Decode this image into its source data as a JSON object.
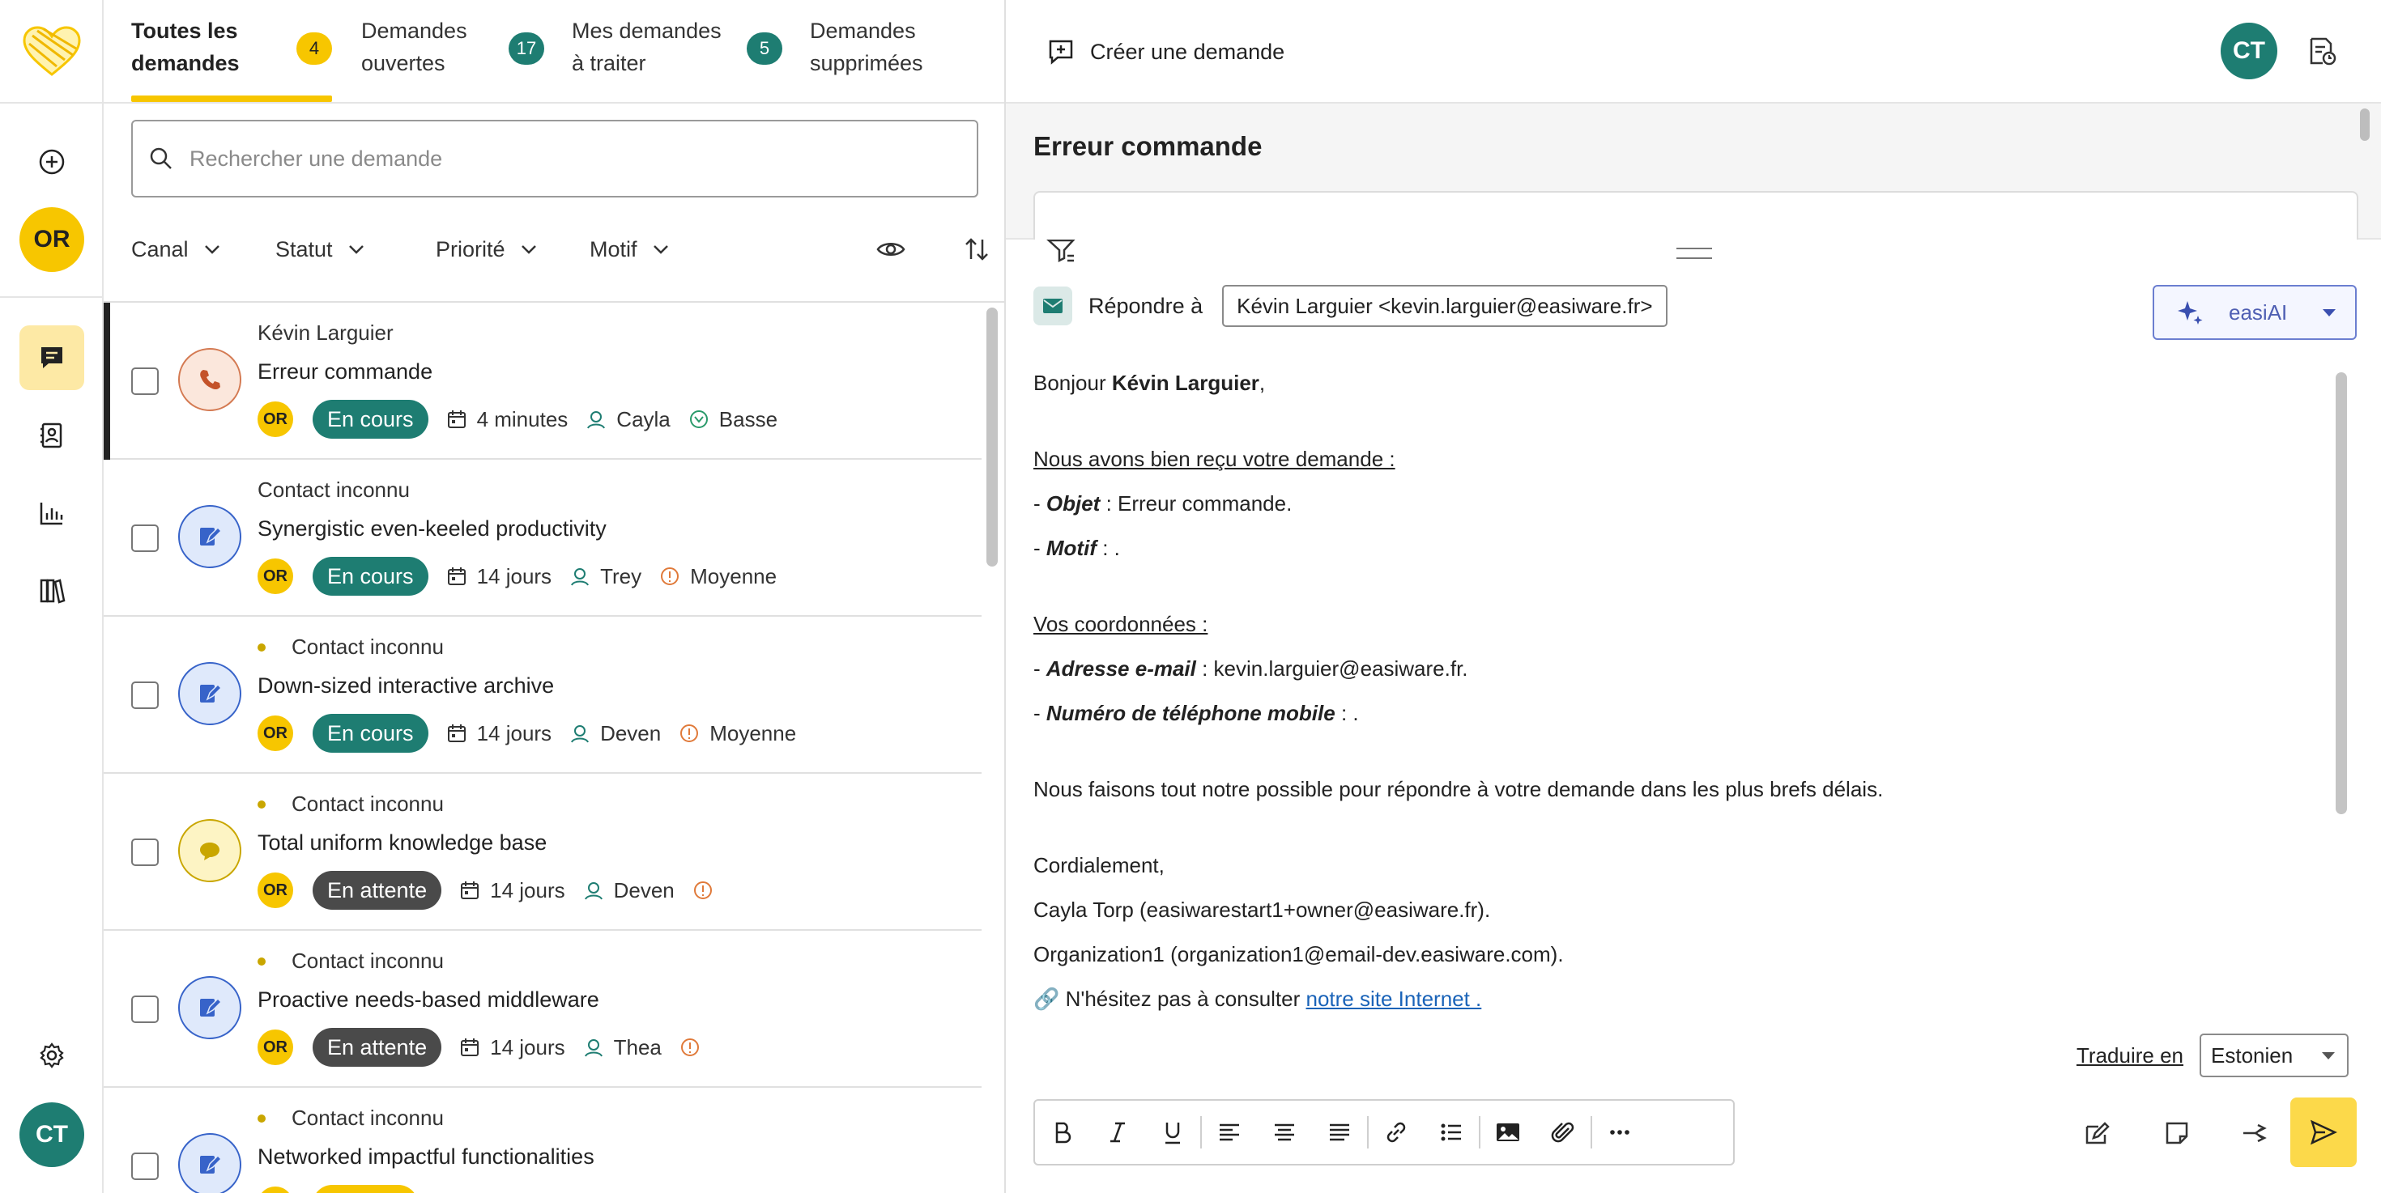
{
  "tabs": [
    {
      "label_line1": "Toutes les",
      "label_line2": "demandes",
      "count": "4",
      "active": true
    },
    {
      "label_line1": "Demandes",
      "label_line2": "ouvertes",
      "count": "17"
    },
    {
      "label_line1": "Mes demandes",
      "label_line2": "à traiter",
      "count": "5"
    },
    {
      "label_line1": "Demandes",
      "label_line2": "supprimées"
    }
  ],
  "rail": {
    "user_initials_or": "OR",
    "user_initials_ct": "CT"
  },
  "search": {
    "placeholder": "Rechercher une demande"
  },
  "filters": [
    "Canal",
    "Statut",
    "Priorité",
    "Motif"
  ],
  "requests": [
    {
      "contact": "Kévin Larguier",
      "subject": "Erreur commande",
      "channel": "phone",
      "assignee_initials": "OR",
      "status": "En cours",
      "status_color": "#1e7d72",
      "age": "4 minutes",
      "agent": "Cayla",
      "priority": "Basse",
      "unread": false,
      "selected": true
    },
    {
      "contact": "Contact inconnu",
      "subject": "Synergistic even-keeled productivity",
      "channel": "form",
      "assignee_initials": "OR",
      "status": "En cours",
      "status_color": "#1e7d72",
      "age": "14 jours",
      "agent": "Trey",
      "priority": "Moyenne",
      "unread": false
    },
    {
      "contact": "Contact inconnu",
      "subject": "Down-sized interactive archive",
      "channel": "form",
      "assignee_initials": "OR",
      "status": "En cours",
      "status_color": "#1e7d72",
      "age": "14 jours",
      "agent": "Deven",
      "priority": "Moyenne",
      "unread": true
    },
    {
      "contact": "Contact inconnu",
      "subject": "Total uniform knowledge base",
      "channel": "chat",
      "assignee_initials": "OR",
      "status": "En attente",
      "status_color": "#4a4a4a",
      "age": "14 jours",
      "agent": "Deven",
      "priority": "",
      "unread": true
    },
    {
      "contact": "Contact inconnu",
      "subject": "Proactive needs-based middleware",
      "channel": "form",
      "assignee_initials": "OR",
      "status": "En attente",
      "status_color": "#4a4a4a",
      "age": "14 jours",
      "agent": "Thea",
      "priority": "",
      "unread": true
    },
    {
      "contact": "Contact inconnu",
      "subject": "Networked impactful functionalities",
      "channel": "form",
      "assignee_initials": "",
      "status": "",
      "status_color": "#f7c600",
      "age": "",
      "agent": "",
      "priority": "",
      "unread": true
    }
  ],
  "detail": {
    "create_label": "Créer une demande",
    "user_initials": "CT",
    "subject": "Erreur commande",
    "reply_label": "Répondre à",
    "reply_to": "Kévin Larguier <kevin.larguier@easiware.fr>",
    "ai_label": "easiAI",
    "translate_label": "Traduire en",
    "translate_language": "Estonien"
  },
  "email": {
    "greeting": "Bonjour ",
    "greeting_name": "Kévin Larguier",
    "greeting_end": ",",
    "received": "Nous avons bien reçu votre demande :",
    "object_label": "Objet",
    "object_value": " : Erreur commande.",
    "motif_label": "Motif",
    "motif_value": " : .",
    "coords_title": "Vos coordonnées :",
    "email_label": "Adresse e-mail",
    "email_value": " : kevin.larguier@easiware.fr.",
    "phone_label": "Numéro de téléphone mobile",
    "phone_value": " : .",
    "promise": "Nous faisons tout notre possible pour répondre à votre demande dans les plus brefs délais.",
    "closing": "Cordialement,",
    "signature1": "Cayla Torp (easiwarestart1+owner@easiware.fr).",
    "signature2": "Organization1 (organization1@email-dev.easiware.com).",
    "link_prefix": "🔗 N'hésitez pas à consulter ",
    "link_text": "notre site Internet ."
  },
  "colors": {
    "accent_yellow": "#f7c600",
    "teal": "#1e7d72",
    "send_yellow": "#fcd94a",
    "ai_purple": "#4f5fb3"
  }
}
